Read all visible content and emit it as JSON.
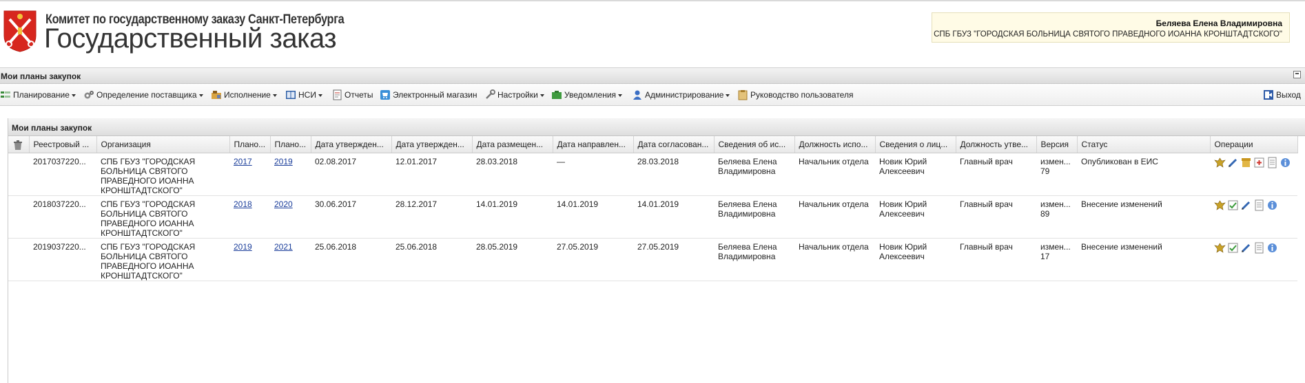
{
  "header": {
    "committee": "Комитет по государственному заказу Санкт-Петербурга",
    "site_title": "Государственный заказ",
    "user_name": "Беляева Елена Владимировна",
    "user_org": "СПБ ГБУЗ \"ГОРОДСКАЯ БОЛЬНИЦА СВЯТОГО ПРАВЕДНОГО ИОАННА КРОНШТАДТСКОГО\""
  },
  "page": {
    "title": "Мои планы закупок"
  },
  "menu": {
    "planning": "Планирование",
    "supplier": "Определение поставщика",
    "execution": "Исполнение",
    "nsi": "НСИ",
    "reports": "Отчеты",
    "eshop": "Электронный магазин",
    "settings": "Настройки",
    "notifications": "Уведомления",
    "admin": "Администрирование",
    "manual": "Руководство пользователя",
    "exit": "Выход"
  },
  "grid": {
    "title": "Мои планы закупок",
    "columns": [
      "Реестровый ...",
      "Организация",
      "Плано...",
      "Плано...",
      "Дата утвержден...",
      "Дата утвержден...",
      "Дата размещен...",
      "Дата направлен...",
      "Дата согласован...",
      "Сведения об ис...",
      "Должность испо...",
      "Сведения о лиц...",
      "Должность утве...",
      "Версия",
      "Статус",
      "Операции"
    ],
    "rows": [
      {
        "reg": "2017037220...",
        "org": "СПБ ГБУЗ \"ГОРОДСКАЯ БОЛЬНИЦА СВЯТОГО ПРАВЕДНОГО ИОАННА КРОНШТАДТСКОГО\"",
        "y1": "2017",
        "y2": "2019",
        "d1": "02.08.2017",
        "d2": "12.01.2017",
        "d3": "28.03.2018",
        "d4": "—",
        "d5": "28.03.2018",
        "exec": "Беляева Елена Владимировна",
        "exec_pos": "Начальник отдела",
        "appr": "Новик Юрий Алексеевич",
        "appr_pos": "Главный врач",
        "version": "измен... 79",
        "status": "Опубликован в ЕИС"
      },
      {
        "reg": "2018037220...",
        "org": "СПБ ГБУЗ \"ГОРОДСКАЯ БОЛЬНИЦА СВЯТОГО ПРАВЕДНОГО ИОАННА КРОНШТАДТСКОГО\"",
        "y1": "2018",
        "y2": "2020",
        "d1": "30.06.2017",
        "d2": "28.12.2017",
        "d3": "14.01.2019",
        "d4": "14.01.2019",
        "d5": "14.01.2019",
        "exec": "Беляева Елена Владимировна",
        "exec_pos": "Начальник отдела",
        "appr": "Новик Юрий Алексеевич",
        "appr_pos": "Главный врач",
        "version": "измен... 89",
        "status": "Внесение изменений"
      },
      {
        "reg": "2019037220...",
        "org": "СПБ ГБУЗ \"ГОРОДСКАЯ БОЛЬНИЦА СВЯТОГО ПРАВЕДНОГО ИОАННА КРОНШТАДТСКОГО\"",
        "y1": "2019",
        "y2": "2021",
        "d1": "25.06.2018",
        "d2": "25.06.2018",
        "d3": "28.05.2019",
        "d4": "27.05.2019",
        "d5": "27.05.2019",
        "exec": "Беляева Елена Владимировна",
        "exec_pos": "Начальник отдела",
        "appr": "Новик Юрий Алексеевич",
        "appr_pos": "Главный врач",
        "version": "измен... 17",
        "status": "Внесение изменений"
      }
    ]
  }
}
